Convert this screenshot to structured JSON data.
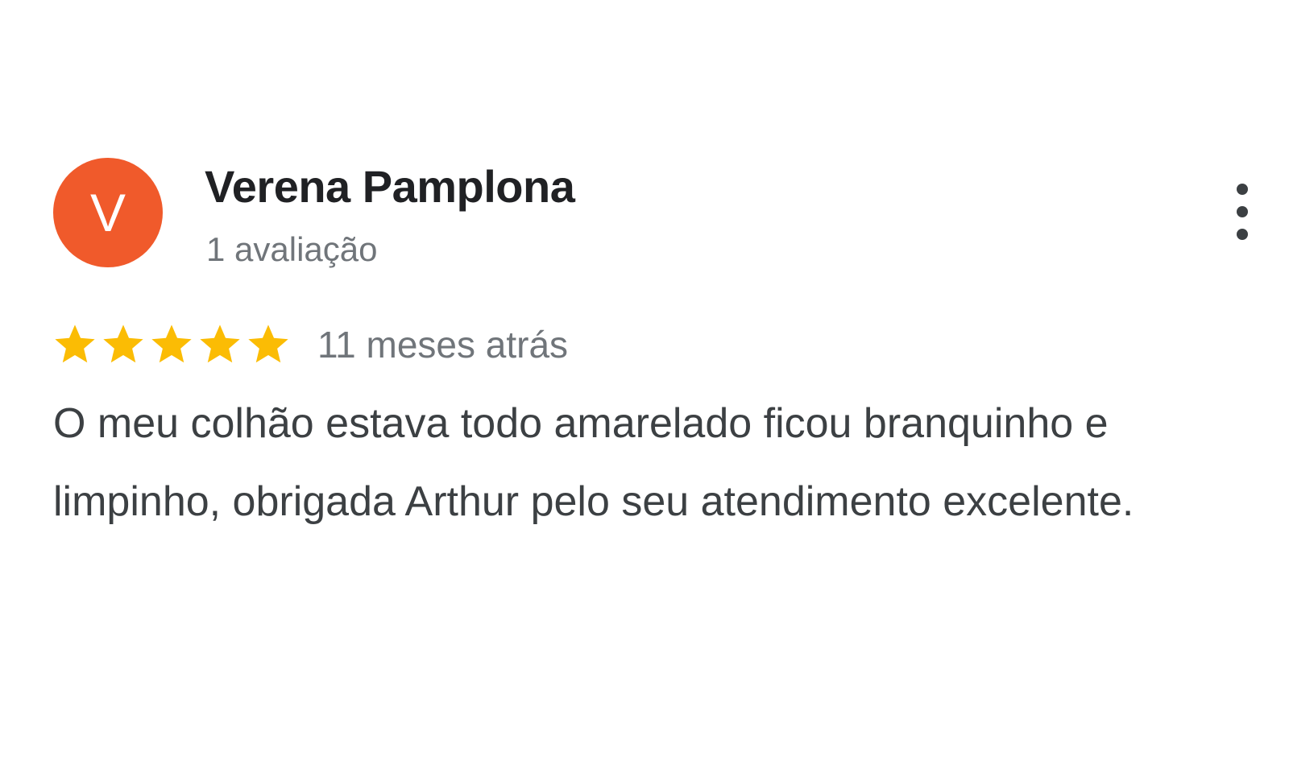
{
  "review": {
    "avatar_letter": "V",
    "avatar_color": "#f05a2b",
    "author_name": "Verena Pamplona",
    "review_count": "1 avaliação",
    "rating": 5,
    "rating_max": 5,
    "star_color": "#fbbc04",
    "date": "11 meses atrás",
    "text": "O meu colhão estava todo amarelado ficou branquinho e limpinho, obrigada Arthur pelo seu atendimento excelente."
  },
  "icons": {
    "more": "more-vert-icon",
    "star": "star-icon"
  }
}
